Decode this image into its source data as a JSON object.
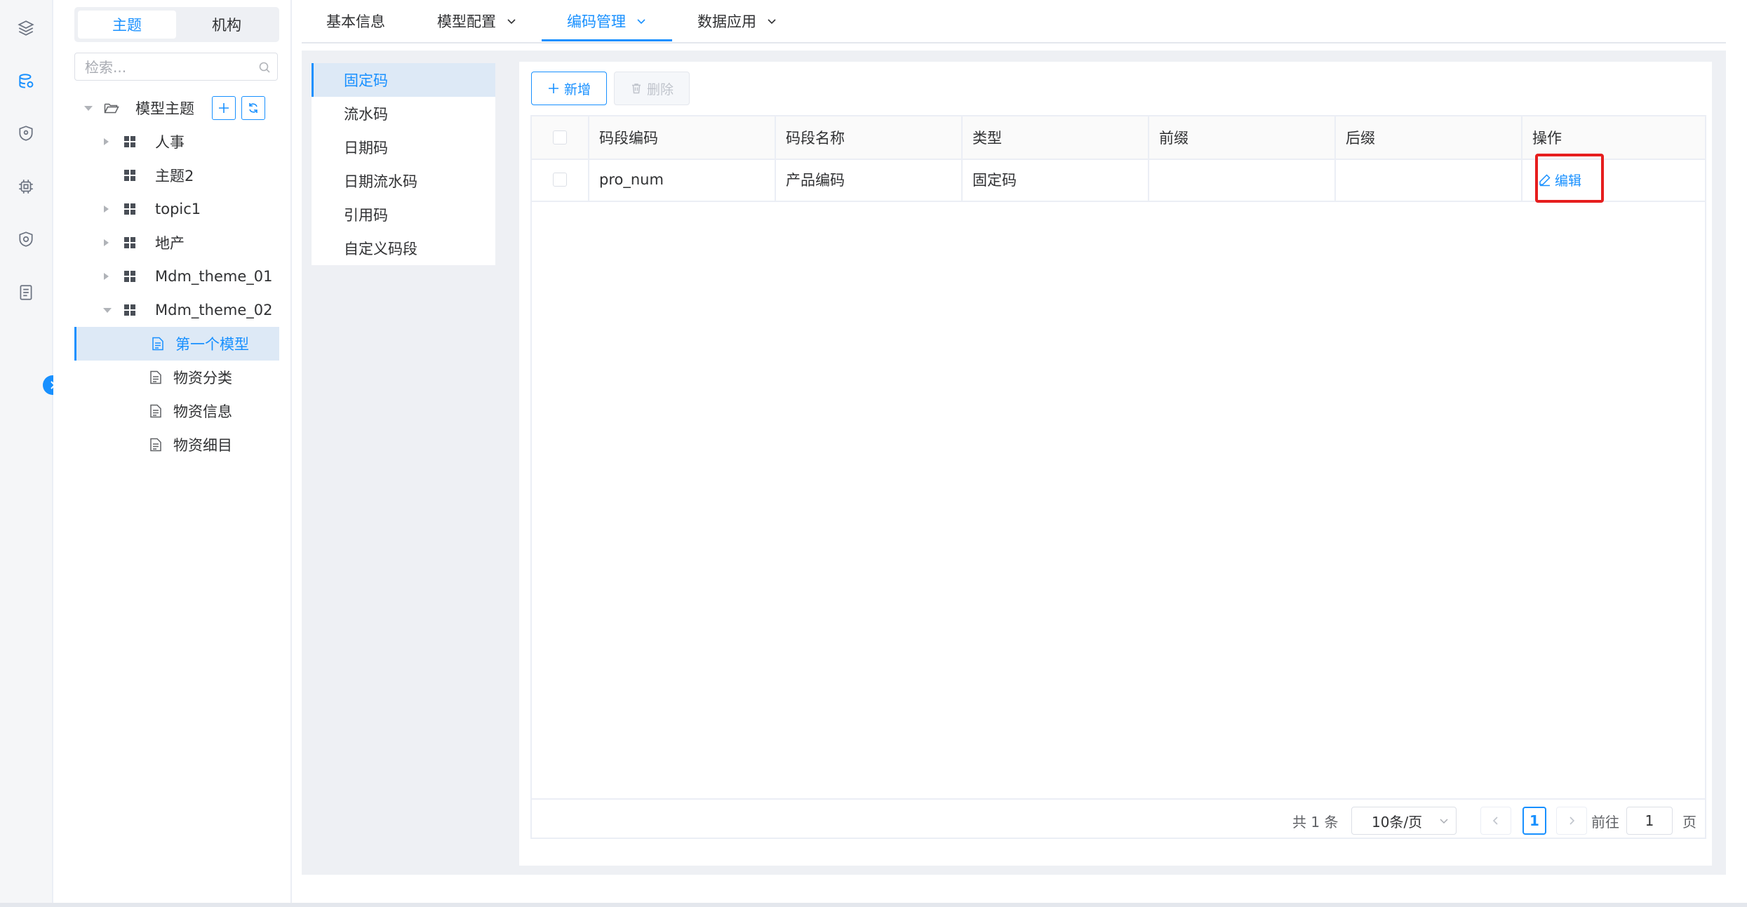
{
  "rail": {
    "icons": [
      "layers-icon",
      "database-icon",
      "shield-pin-icon",
      "chip-icon",
      "shield-eye-icon",
      "document-list-icon"
    ]
  },
  "tree": {
    "tabs": [
      "主题",
      "机构"
    ],
    "search_placeholder": "检索...",
    "root_label": "模型主题",
    "items": [
      {
        "label": "人事",
        "type": "theme",
        "arrow": "right"
      },
      {
        "label": "主题2",
        "type": "theme",
        "arrow": "none"
      },
      {
        "label": "topic1",
        "type": "theme",
        "arrow": "right"
      },
      {
        "label": "地产",
        "type": "theme",
        "arrow": "right"
      },
      {
        "label": "Mdm_theme_01",
        "type": "theme",
        "arrow": "right"
      },
      {
        "label": "Mdm_theme_02",
        "type": "theme",
        "arrow": "down"
      },
      {
        "label": "第一个模型",
        "type": "model",
        "selected": true
      },
      {
        "label": "物资分类",
        "type": "model"
      },
      {
        "label": "物资信息",
        "type": "model"
      },
      {
        "label": "物资细目",
        "type": "model"
      }
    ]
  },
  "top_tabs": [
    {
      "label": "基本信息",
      "dropdown": false
    },
    {
      "label": "模型配置",
      "dropdown": true
    },
    {
      "label": "编码管理",
      "dropdown": true,
      "active": true
    },
    {
      "label": "数据应用",
      "dropdown": true
    }
  ],
  "code_menu": [
    "固定码",
    "流水码",
    "日期码",
    "日期流水码",
    "引用码",
    "自定义码段"
  ],
  "toolbar": {
    "add_label": "新增",
    "delete_label": "删除"
  },
  "table": {
    "columns": [
      "码段编码",
      "码段名称",
      "类型",
      "前缀",
      "后缀",
      "操作"
    ],
    "rows": [
      {
        "code": "pro_num",
        "name": "产品编码",
        "type": "固定码",
        "prefix": "",
        "suffix": "",
        "action": "编辑"
      }
    ]
  },
  "pagination": {
    "total_text": "共 1 条",
    "page_size": "10条/页",
    "current_page": "1",
    "goto_label": "前往",
    "goto_value": "1",
    "page_suffix": "页"
  },
  "colors": {
    "accent": "#1890ff",
    "highlight": "#e61e1e"
  }
}
